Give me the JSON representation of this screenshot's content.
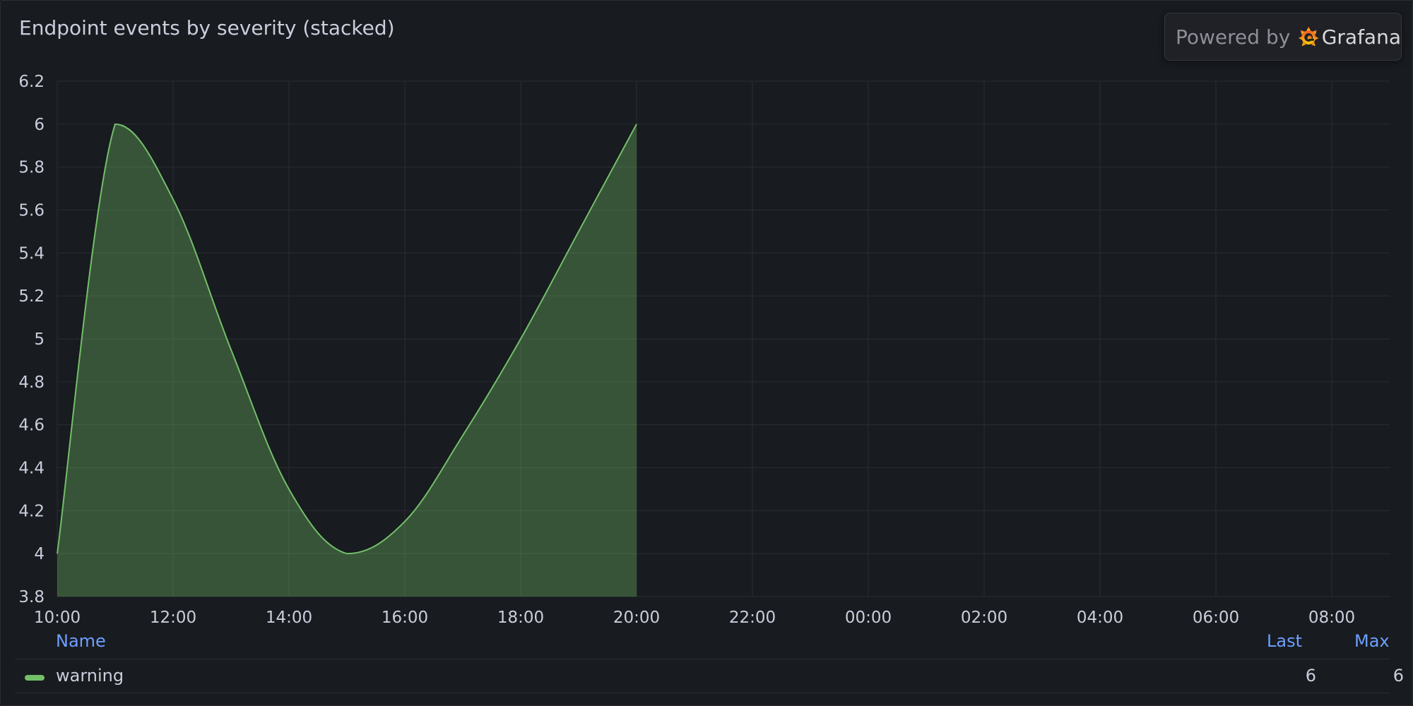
{
  "panel": {
    "title": "Endpoint events by severity (stacked)",
    "powered_by": "Powered by",
    "brand": "Grafana"
  },
  "legend": {
    "header_name": "Name",
    "header_last": "Last",
    "header_max": "Max",
    "rows": [
      {
        "name": "warning",
        "last": "6",
        "max": "6",
        "color": "#73bf69"
      }
    ]
  },
  "chart_data": {
    "type": "area",
    "title": "Endpoint events by severity (stacked)",
    "stacked": true,
    "grid": true,
    "ylim": [
      3.8,
      6.2
    ],
    "yticks": [
      "6.2",
      "6",
      "5.8",
      "5.6",
      "5.4",
      "5.2",
      "5",
      "4.8",
      "4.6",
      "4.4",
      "4.2",
      "4",
      "3.8"
    ],
    "x_range": [
      "10:00",
      "09:00 (+1 day)"
    ],
    "xticks": [
      "10:00",
      "12:00",
      "14:00",
      "16:00",
      "18:00",
      "20:00",
      "22:00",
      "00:00",
      "02:00",
      "04:00",
      "06:00",
      "08:00"
    ],
    "legend_position": "bottom",
    "series": [
      {
        "name": "warning",
        "color": "#73bf69",
        "x": [
          "10:00",
          "11:00",
          "12:00",
          "13:00",
          "14:00",
          "15:00",
          "16:00",
          "17:00",
          "18:00",
          "19:00",
          "20:00"
        ],
        "values": [
          4.0,
          6.0,
          5.65,
          4.95,
          4.3,
          4.0,
          4.15,
          4.55,
          5.0,
          5.5,
          6.0
        ]
      }
    ]
  }
}
